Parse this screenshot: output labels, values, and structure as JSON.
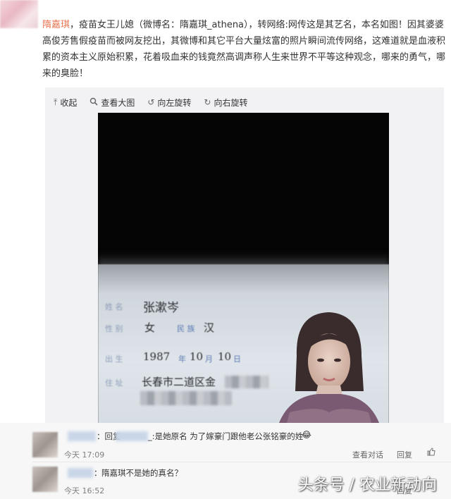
{
  "post": {
    "author": "隋嘉琪",
    "text": "，疫苗女王儿媳（微博名：隋嘉琪_athena），转网络:网传这是其艺名，本名如图！因其婆婆高俊芳售假疫苗而被网友挖出，其微博和其它平台大量炫富的照片瞬间流传网络，这难道就是血液积累的资本主义原始积累，花着吸血来的钱竟然高调声称人生来世界不平等这种观念，哪来的勇气，哪来的臭脸！"
  },
  "toolbar": {
    "collapse_label": "收起",
    "view_large_label": "查看大图",
    "rotate_left_label": "向左旋转",
    "rotate_right_label": "向右旋转"
  },
  "id_card": {
    "name_field_label": "姓 名",
    "name_value": "张漱岑",
    "sex_field_label": "性 别",
    "sex_value": "女",
    "ethnicity_label": "民 族",
    "ethnicity_value": "汉",
    "birth_field_label": "出 生",
    "birth_year": "1987",
    "year_char": "年",
    "birth_month": "10",
    "month_char": "月",
    "birth_day": "10",
    "day_char": "日",
    "address_field_label": "住 址",
    "address_value": "长春市二道区金"
  },
  "comments": [
    {
      "prefix": "：回复",
      "text": "_:是她原名 为了嫁豪门跟他老公张铭豪的姓",
      "emoji": "😂",
      "time": "今天 17:09",
      "actions": [
        "查看对话",
        "回复"
      ]
    },
    {
      "prefix": "：",
      "text": "隋嘉琪不是她的真名？",
      "time": "今天 16:52",
      "actions": [
        "回复"
      ]
    }
  ],
  "watermark": "头条号 / 农业新动向",
  "colors": {
    "author": "#eb7350",
    "panel_bg": "#f2f2f5",
    "comment_bg": "#f7f7f7"
  },
  "icons": [
    "collapse-icon",
    "magnifier-icon",
    "rotate-left-icon",
    "rotate-right-icon",
    "thumbs-up-icon"
  ]
}
